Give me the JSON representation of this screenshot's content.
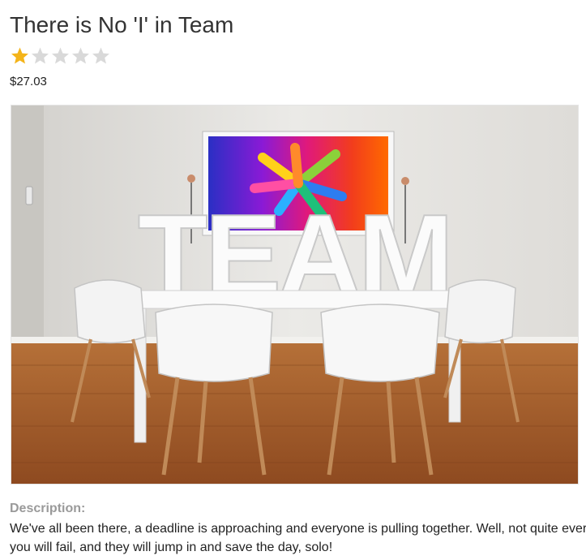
{
  "product": {
    "title": "There is No 'I' in Team",
    "rating": 1,
    "rating_max": 5,
    "price": "$27.03",
    "image": {
      "icon": "team-conference-room-image",
      "overlay_text": "TEAM"
    },
    "description_label": "Description:",
    "description_text": "We've all been there, a deadline is approaching and everyone is pulling together. Well, not quite ever\nyou will fail, and they will jump in and save the day, solo!"
  },
  "colors": {
    "star_filled": "#f4b41a",
    "star_empty": "#d9d9d9",
    "label_gray": "#9a9a9a"
  }
}
